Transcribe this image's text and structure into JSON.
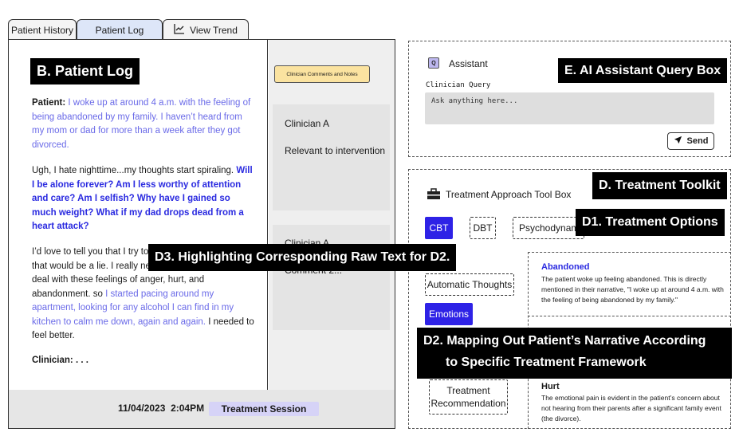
{
  "tabs": {
    "history": "Patient History",
    "log": "Patient Log",
    "trend": "View Trend"
  },
  "labels": {
    "patient_log": "B. Patient Log",
    "ai_assistant": "E. AI Assistant Query Box",
    "toolkit": "D. Treatment Toolkit",
    "options": "D1. Treatment Options",
    "highlighting": "D3. Highlighting Corresponding Raw Text for D2.",
    "mapping_line1": "D2. Mapping Out Patient’s Narrative According",
    "mapping_line2": "to Specific Treatment Framework"
  },
  "log": {
    "p1_speaker": "Patient:",
    "p1_text": "I woke up at around 4 a.m. with the feeling of being abandoned by my family. I haven’t heard from my mom or dad for more than a week after they got divorced.",
    "p2_plain": "Ugh, I hate nighttime...my thoughts start spiraling.",
    "p2_bold": "Will I be alone forever? Am I less worthy of attention and care? Am I selfish? Why have I gained so much weight? What if my dad drops dead from a heart attack?",
    "p3_a": "I’d love to tell you that I try to",
    "p3_b": "that would be a lie. I really nee",
    "p3_c": "deal with these feelings of anger, hurt, and abandonment. so",
    "p3_blue": "I started pacing around my apartment, looking for any alcohol I can find in my kitchen to calm me down, again and again.",
    "p3_end": "I needed to feel better.",
    "clinician": "Clinician: . . ."
  },
  "comments": {
    "button": "Clinician Comments and Notes",
    "card1_name": "Clinician A",
    "card1_note": "Relevant to intervention",
    "card2_name": "Clinician A",
    "card2_note": "Comment 2..."
  },
  "footer": {
    "date": "11/04/2023",
    "time": "2:04PM",
    "session": "Treatment Session"
  },
  "assistant": {
    "icon_letter": "Q",
    "title": "Assistant",
    "query_label": "Clinician Query",
    "placeholder": "Ask anything here...",
    "send": "Send"
  },
  "toolkit": {
    "title": "Treatment Approach Tool Box",
    "options": [
      "CBT",
      "DBT",
      "Psychodynam"
    ],
    "categories": [
      "Automatic Thoughts",
      "Emotions",
      "Treatment Recommendation"
    ]
  },
  "cards": [
    {
      "title": "Abandoned",
      "text": "The patient woke up feeling abandoned. This is directly mentioned in their narrative, \"I woke up at around 4 a.m. with the feeling of being abandoned by my family.\""
    },
    {
      "title": "Hurt",
      "text": "The emotional pain is evident in the patient’s concern about not hearing from their parents after a significant family event (the divorce)."
    }
  ],
  "colors": {
    "selected": "#2e22e6",
    "patient_text": "#6a6ae8",
    "emphasis_text": "#2a2ae0",
    "comments_button": "#fbe3a0",
    "session_badge": "#d6d3f7"
  }
}
